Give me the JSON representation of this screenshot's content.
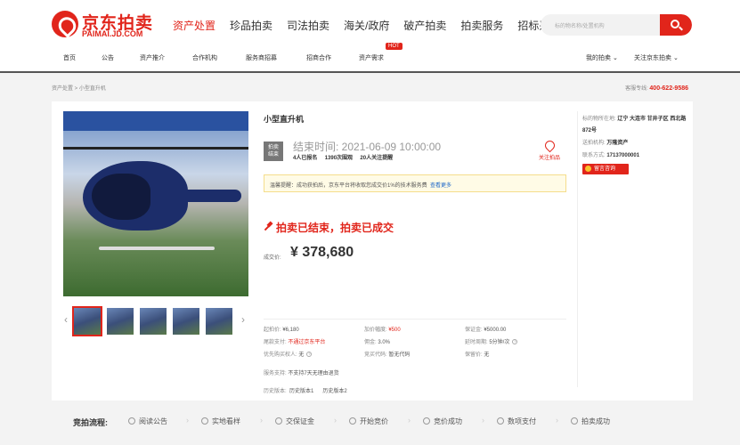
{
  "header": {
    "logo_cn": "京东拍卖",
    "logo_en": "PAIMAI.JD.COM",
    "main_nav": [
      "资产处置",
      "珍品拍卖",
      "司法拍卖",
      "海关/政府",
      "破产拍卖",
      "拍卖服务",
      "招标采购"
    ],
    "active_nav_index": 0,
    "search_placeholder": "标的物名称/处置机构",
    "sub_nav": [
      "首页",
      "公告",
      "资产推介",
      "合作机构",
      "服务商招募",
      "招商合作",
      "资产需求"
    ],
    "hot_badge": "HOT",
    "user_links": [
      "我的拍卖 ⌄",
      "关注京东拍卖 ⌄"
    ],
    "accent_color": "#e1251b"
  },
  "breadcrumb": "资产处置 > 小型直升机",
  "hotline_label": "客服专线:",
  "hotline_number": "400-622-9586",
  "item": {
    "title": "小型直升机",
    "status_badge_line1": "拍卖",
    "status_badge_line2": "结束",
    "end_time": "结束时间: 2021-06-09 10:00:00",
    "signups": "4人已报名",
    "views": "1390次围观",
    "followers": "20人关注提醒",
    "follow_label": "关注拍品",
    "notice_text": "温馨提醒：成功获拍后，京东平台将收取您成交价1%的技术服务费",
    "notice_link": "查看更多",
    "result_text": "拍卖已结束，拍卖已成交",
    "price_label": "成交价:",
    "price": "¥ 378,680",
    "params": {
      "start_price_label": "起拍价:",
      "start_price": "¥6,180",
      "increment_label": "加价幅度:",
      "increment": "¥500",
      "deposit_label": "保证金:",
      "deposit": "¥5000.00",
      "tail_label": "尾款支付:",
      "tail": "不通过京东平台",
      "commission_label": "佣金:",
      "commission": "3.0%",
      "delay_label": "延时周期:",
      "delay": "5分钟/次",
      "priority_label": "优先购买权人:",
      "priority": "无",
      "bid_code_label": "竞买代码:",
      "bid_code": "暂无代码",
      "reserve_label": "保留价:",
      "reserve": "无",
      "service_label": "服务支持:",
      "service": "不支持7天无理由退货",
      "history_label": "历史版本:",
      "history_v1": "历史版本1",
      "history_v2": "历史版本2"
    }
  },
  "seller": {
    "location_label": "标的物所在地:",
    "location": "辽宁 大连市 甘井子区 西北路872号",
    "agency_label": "送拍机构:",
    "agency": "万隆资产",
    "contact_label": "联系方式:",
    "contact": "17137000001",
    "message_button": "留言咨询"
  },
  "flow": {
    "title": "竞拍流程:",
    "steps": [
      "阅读公告",
      "实地看样",
      "交保证金",
      "开始竞价",
      "竞价成功",
      "数项支付",
      "拍卖成功"
    ]
  }
}
